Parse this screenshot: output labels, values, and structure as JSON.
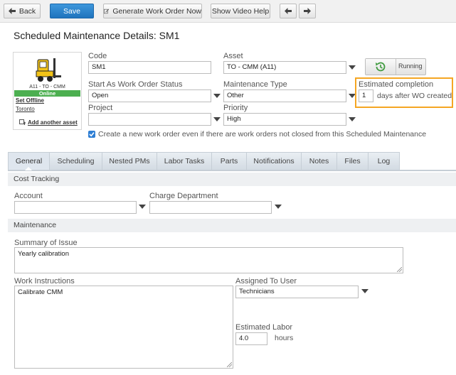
{
  "toolbar": {
    "back_label": "Back",
    "save_label": "Save",
    "generate_label": "Generate Work Order Now",
    "video_label": "Show Video Help"
  },
  "page": {
    "title": "Scheduled Maintenance Details: SM1"
  },
  "asset_card": {
    "name": "A11 - TO - CMM",
    "status": "Online",
    "set_offline_label": "Set Offline",
    "location_label": "Toronto",
    "add_asset_label": "Add another asset",
    "status_color": "#4caf50"
  },
  "form": {
    "code": {
      "label": "Code",
      "value": "SM1"
    },
    "asset": {
      "label": "Asset",
      "value": "TO - CMM (A11)"
    },
    "start_status": {
      "label": "Start As Work Order Status",
      "value": "Open"
    },
    "maintenance_type": {
      "label": "Maintenance Type",
      "value": "Other"
    },
    "project": {
      "label": "Project",
      "value": ""
    },
    "priority": {
      "label": "Priority",
      "value": "High"
    },
    "running_label": "Running",
    "estimated_completion": {
      "label": "Estimated completion",
      "value": "1",
      "suffix": "days after WO created"
    },
    "create_new_label": "Create a new work order even if there are work orders not closed from this Scheduled Maintenance",
    "create_new_checked": true
  },
  "tabs": [
    {
      "label": "General",
      "active": true
    },
    {
      "label": "Scheduling"
    },
    {
      "label": "Nested PMs"
    },
    {
      "label": "Labor Tasks"
    },
    {
      "label": "Parts"
    },
    {
      "label": "Notifications"
    },
    {
      "label": "Notes"
    },
    {
      "label": "Files"
    },
    {
      "label": "Log"
    }
  ],
  "cost_tracking": {
    "title": "Cost Tracking",
    "account": {
      "label": "Account",
      "value": ""
    },
    "charge_department": {
      "label": "Charge Department",
      "value": ""
    }
  },
  "maintenance": {
    "title": "Maintenance",
    "summary": {
      "label": "Summary of Issue",
      "value": "Yearly calibration"
    },
    "instructions": {
      "label": "Work Instructions",
      "value": "Calibrate CMM"
    },
    "assigned_to": {
      "label": "Assigned To User",
      "value": "Technicians"
    },
    "estimated_labor": {
      "label": "Estimated Labor",
      "value": "4.0",
      "unit": "hours"
    }
  },
  "colors": {
    "primary_button": "#2a84cc",
    "highlight_border": "#f5a623",
    "checkbox": "#2f7fd4"
  }
}
